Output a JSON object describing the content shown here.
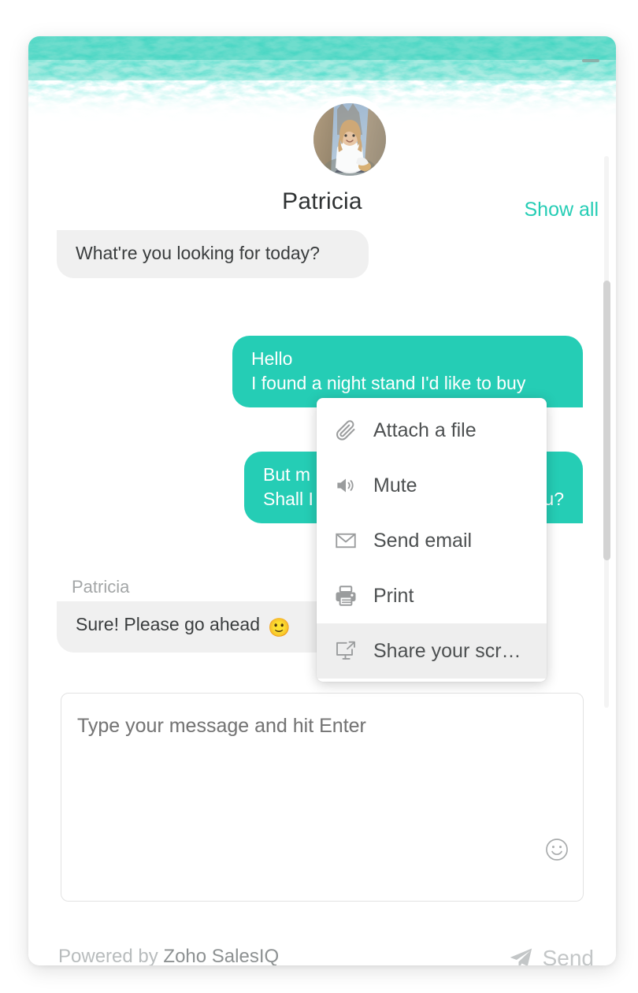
{
  "brand": {
    "accent_color": "#25cdb5",
    "incoming_bubble_color": "#f0f0f0",
    "outgoing_bubble_color": "#25cdb5"
  },
  "header": {
    "agent_name": "Patricia",
    "show_all_label": "Show all",
    "minimize_icon": "minimize-icon",
    "avatar_icon": "avatar-photo"
  },
  "chat": {
    "messages": [
      {
        "id": "m1",
        "direction": "incoming",
        "text": "What're you looking for today?"
      },
      {
        "id": "m2",
        "direction": "outgoing",
        "line1": "Hello",
        "line2": "I found a night stand I'd like to buy"
      },
      {
        "id": "m3",
        "direction": "outgoing",
        "line1": "But m",
        "line2_start": "Shall I",
        "line2_end": "u?"
      },
      {
        "id": "m4",
        "direction": "incoming",
        "sender_label": "Patricia",
        "text": "Sure! Please go ahead",
        "emoji": "🙂"
      }
    ],
    "power_icon": "power-icon",
    "scrollbar": "vertical-scrollbar"
  },
  "menu": {
    "items": [
      {
        "label": "Attach a file",
        "icon": "paperclip-icon",
        "active": false
      },
      {
        "label": "Mute",
        "icon": "speaker-icon",
        "active": false
      },
      {
        "label": "Send email",
        "icon": "envelope-icon",
        "active": false
      },
      {
        "label": "Print",
        "icon": "printer-icon",
        "active": false
      },
      {
        "label": "Share your scr…",
        "icon": "screen-share-icon",
        "active": true
      }
    ]
  },
  "composer": {
    "placeholder": "Type your message and hit Enter",
    "value": "",
    "emoji_icon": "smiley-icon"
  },
  "footer": {
    "powered_prefix": "Powered by ",
    "powered_brand": "Zoho SalesIQ",
    "send_label": "Send",
    "send_icon": "paper-plane-icon"
  }
}
